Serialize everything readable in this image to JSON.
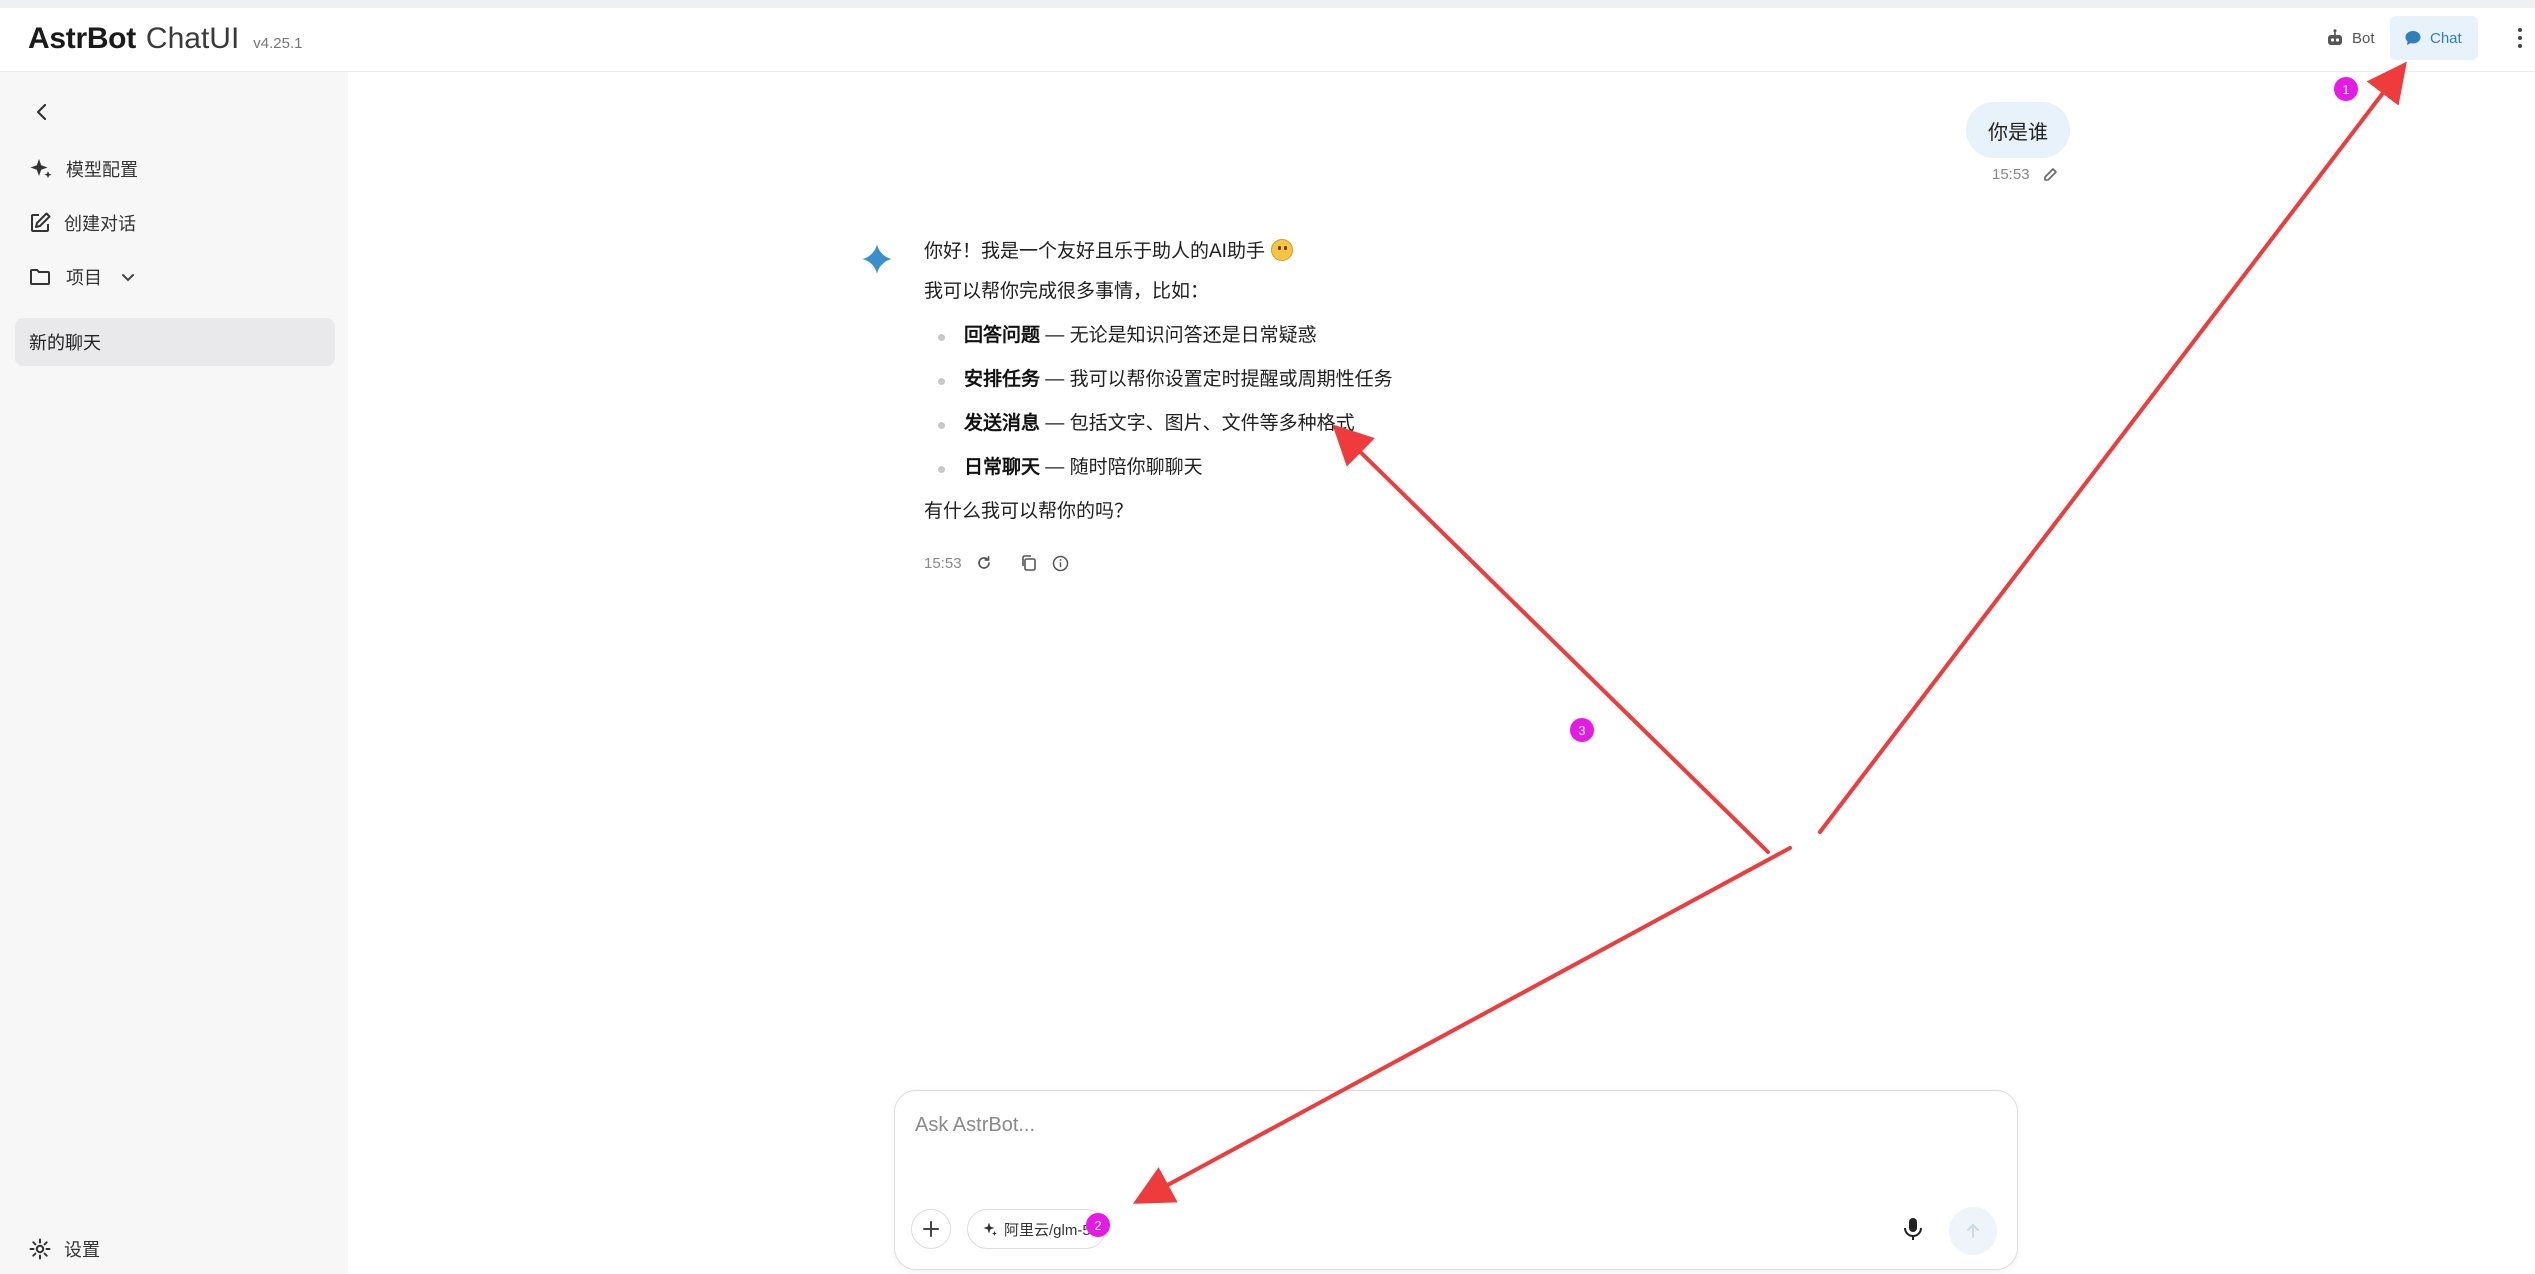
{
  "header": {
    "brand_main": "AstrBot",
    "brand_sub": "ChatUI",
    "version": "v4.25.1",
    "bot_label": "Bot",
    "chat_label": "Chat"
  },
  "sidebar": {
    "model_config": "模型配置",
    "new_conversation": "创建对话",
    "projects": "项目",
    "chat_entry": "新的聊天",
    "settings": "设置"
  },
  "user_message": {
    "text": "你是谁",
    "time": "15:53"
  },
  "bot_message": {
    "line1": "你好！我是一个友好且乐于助人的AI助手",
    "line2": "我可以帮你完成很多事情，比如：",
    "bullets": [
      {
        "title": "回答问题",
        "desc": " — 无论是知识问答还是日常疑惑"
      },
      {
        "title": "安排任务",
        "desc": " — 我可以帮你设置定时提醒或周期性任务"
      },
      {
        "title": "发送消息",
        "desc": " — 包括文字、图片、文件等多种格式"
      },
      {
        "title": "日常聊天",
        "desc": " — 随时陪你聊聊天"
      }
    ],
    "closing": "有什么我可以帮你的吗？",
    "time": "15:53"
  },
  "input": {
    "placeholder": "Ask AstrBot...",
    "model_label": "阿里云/glm-5"
  },
  "annotations": {
    "badge1": "1",
    "badge2": "2",
    "badge3": "3"
  },
  "colors": {
    "accent": "#2f7fbd",
    "arrow": "#ef3b3b",
    "badge": "#e619e6"
  }
}
